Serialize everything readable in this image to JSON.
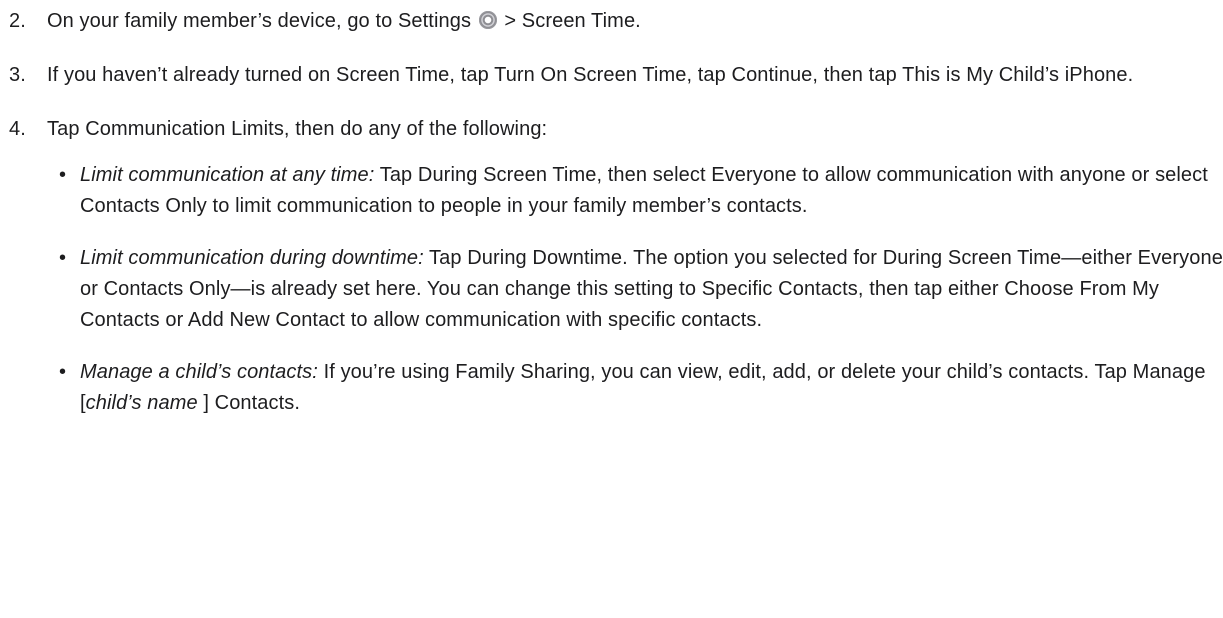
{
  "steps": [
    {
      "number": "2.",
      "text_before": "On your family member’s device, go to Settings ",
      "icon": "settings-gear-icon",
      "text_after": " > Screen Time."
    },
    {
      "number": "3.",
      "text": "If you haven’t already turned on Screen Time, tap Turn On Screen Time, tap Continue, then tap This is My Child’s iPhone."
    },
    {
      "number": "4.",
      "text": "Tap Communication Limits, then do any of the following:",
      "options": [
        {
          "bullet": "•",
          "term": "Limit communication at any time:",
          "text": " Tap During Screen Time, then select Everyone to allow communication with anyone or select Contacts Only to limit communication to people in your family member’s contacts."
        },
        {
          "bullet": "•",
          "term": "Limit communication during downtime:",
          "text": " Tap During Downtime. The option you selected for During Screen Time—either Everyone or Contacts Only—is already set here. You can change this setting to Specific Contacts, then tap either Choose From My Contacts or Add New Contact to allow communication with specific contacts."
        },
        {
          "bullet": "•",
          "term": "Manage a child’s contacts:",
          "text_before": " If you’re using Family Sharing, you can view, edit, add, or delete your child’s contacts. Tap Manage [",
          "placeholder": "child’s name",
          "text_after": " ] Contacts."
        }
      ]
    }
  ]
}
